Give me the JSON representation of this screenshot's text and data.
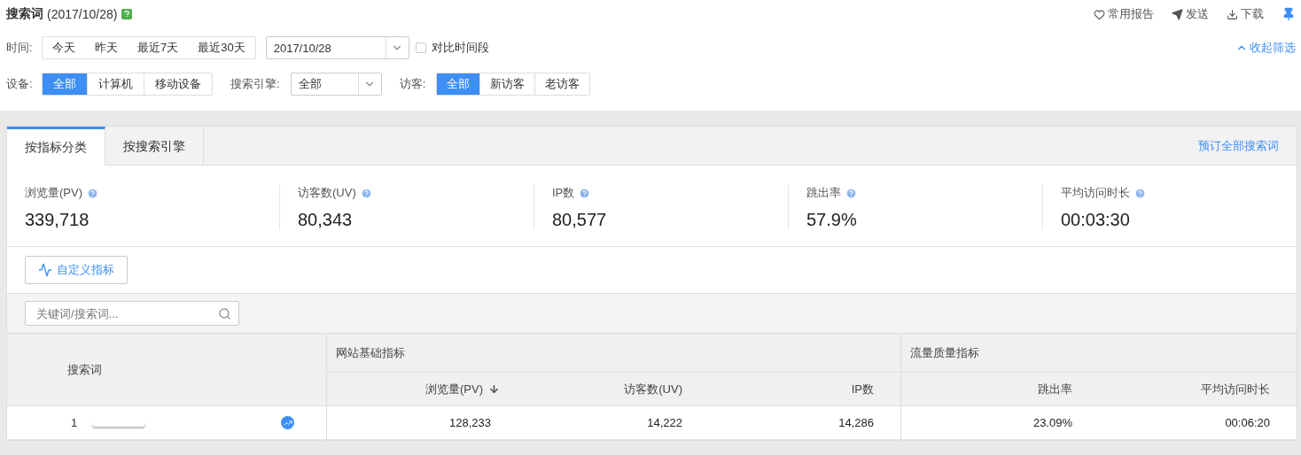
{
  "header": {
    "title": "搜索词",
    "date": "(2017/10/28)",
    "actions": [
      {
        "kind": "favorite",
        "label": "常用报告"
      },
      {
        "kind": "send",
        "label": "发送"
      },
      {
        "kind": "download",
        "label": "下载"
      },
      {
        "kind": "pin"
      }
    ]
  },
  "filters": {
    "time": {
      "label": "时间:",
      "options": [
        {
          "label": "今天",
          "selected": false
        },
        {
          "label": "昨天",
          "selected": false
        },
        {
          "label": "最近7天",
          "selected": false
        },
        {
          "label": "最近30天",
          "selected": false
        }
      ],
      "date": "2017/10/28",
      "compare": {
        "label": "对比时间段",
        "checked": false
      }
    },
    "collapse": "收起筛选",
    "device": {
      "label": "设备:",
      "options": [
        {
          "label": "全部",
          "selected": true
        },
        {
          "label": "计算机",
          "selected": false
        },
        {
          "label": "移动设备",
          "selected": false
        }
      ]
    },
    "engine": {
      "label": "搜索引擎:",
      "value": "全部"
    },
    "visitor": {
      "label": "访客:",
      "options": [
        {
          "label": "全部",
          "selected": true
        },
        {
          "label": "新访客",
          "selected": false
        },
        {
          "label": "老访客",
          "selected": false
        }
      ]
    }
  },
  "tabs": [
    {
      "label": "按指标分类",
      "selected": true
    },
    {
      "label": "按搜索引擎",
      "selected": false
    }
  ],
  "tabs_link": "预订全部搜索词",
  "metrics": [
    {
      "label": "浏览量(PV)",
      "value": "339,718"
    },
    {
      "label": "访客数(UV)",
      "value": "80,343"
    },
    {
      "label": "IP数",
      "value": "80,577"
    },
    {
      "label": "跳出率",
      "value": "57.9%"
    },
    {
      "label": "平均访问时长",
      "value": "00:03:30"
    }
  ],
  "custom_button": "自定义指标",
  "search": {
    "placeholder": "关键词/搜索词..."
  },
  "table": {
    "keyword_header": "搜索词",
    "groups": [
      {
        "title": "网站基础指标",
        "columns": [
          {
            "label": "浏览量(PV)",
            "sorted": true
          },
          {
            "label": "访客数(UV)",
            "sorted": false
          },
          {
            "label": "IP数",
            "sorted": false
          }
        ]
      },
      {
        "title": "流量质量指标",
        "columns": [
          {
            "label": "跳出率",
            "sorted": false
          },
          {
            "label": "平均访问时长",
            "sorted": false
          }
        ]
      }
    ],
    "rows": [
      {
        "rank": "1",
        "cells": [
          "128,233",
          "14,222",
          "14,286",
          "23.09%",
          "00:06:20"
        ]
      }
    ]
  }
}
